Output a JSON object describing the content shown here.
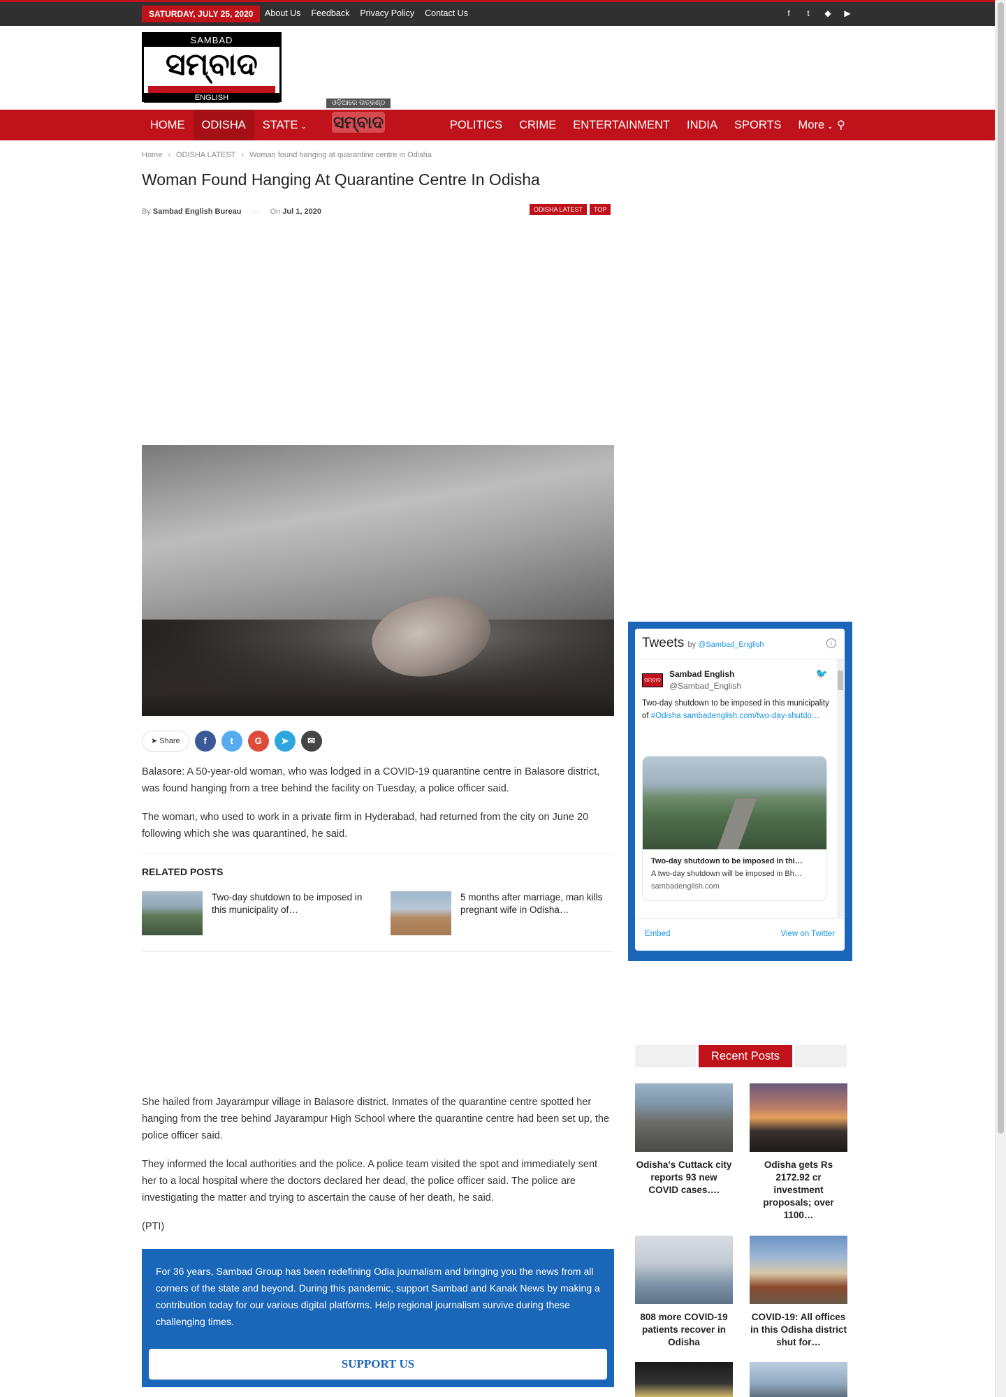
{
  "topbar": {
    "date": "SATURDAY, JULY 25, 2020",
    "links": [
      "About Us",
      "Feedback",
      "Privacy Policy",
      "Contact Us"
    ],
    "social_icons": [
      "facebook-icon",
      "twitter-icon",
      "android-icon",
      "youtube-icon"
    ]
  },
  "logo": {
    "top": "SAMBAD",
    "main": "ସମ୍ବାଦ",
    "bottom": "ENGLISH"
  },
  "nav": {
    "items": [
      "HOME",
      "ODISHA",
      "STATE",
      "POLITICS",
      "CRIME",
      "ENTERTAINMENT",
      "INDIA",
      "SPORTS",
      "More"
    ],
    "active": "ODISHA",
    "center_logo_tag": "ଓଡ଼ିଆରେ ଉତ୍କଣ୍ଠ",
    "center_logo_mark": "ସମ୍ବାଦ"
  },
  "breadcrumb": [
    "Home",
    "ODISHA LATEST",
    "Woman found hanging at quarantine centre in Odisha"
  ],
  "article": {
    "title": "Woman Found Hanging At Quarantine Centre In Odisha",
    "by_label": "By",
    "author": "Sambad English Bureau",
    "on_label": "On",
    "date": "Jul 1, 2020",
    "categories": [
      "ODISHA LATEST",
      "TOP"
    ],
    "share_label": "Share",
    "p1": "Balasore: A 50-year-old woman, who was lodged in a COVID-19 quarantine centre in Balasore district, was found hanging from a tree behind the facility on Tuesday, a police officer said.",
    "p2": "The woman, who used to work in a private firm in Hyderabad, had returned from the city on June 20 following which she was quarantined, he said.",
    "p3": "She hailed from Jayarampur village in Balasore district. Inmates of the quarantine centre spotted her hanging from the tree behind Jayarampur High School where the quarantine centre had been set up, the police officer said.",
    "p4": "They informed the local authorities and the police. A police team visited the spot and immediately sent her to a local hospital where the doctors declared her dead, the police officer said. The police are investigating the matter and trying to ascertain the cause of her death, he said.",
    "p5": "(PTI)"
  },
  "related": {
    "heading": "RELATED POSTS",
    "posts": [
      {
        "title": "Two-day shutdown to be imposed in this municipality of…"
      },
      {
        "title": "5 months after marriage, man kills pregnant wife in Odisha…"
      }
    ]
  },
  "support": {
    "text": "For 36 years, Sambad Group has been redefining Odia journalism and bringing you the news from all corners of the state and beyond. During this pandemic, support Sambad and Kanak News by making a contribution today for our various digital platforms. Help regional journalism survive during these challenging times.",
    "button": "SUPPORT US"
  },
  "twitter": {
    "title": "Tweets",
    "by": "by",
    "handle_link": "@Sambad_English",
    "user_name": "Sambad English",
    "user_handle": "@Sambad_English",
    "tweet_text_a": "Two-day shutdown to be imposed in this municipality of ",
    "tweet_link": "#Odisha sambadenglish.com/two-day-shutdo…",
    "card_title": "Two-day shutdown to be imposed in thi…",
    "card_desc": "A two-day shutdown will be imposed in Bh…",
    "card_url": "sambadenglish.com",
    "embed": "Embed",
    "view_on_twitter": "View on Twitter"
  },
  "recent": {
    "heading": "Recent Posts",
    "posts": [
      {
        "title": "Odisha's Cuttack city reports 93 new COVID cases…."
      },
      {
        "title": "Odisha gets Rs 2172.92 cr investment proposals; over 1100…"
      },
      {
        "title": "808 more COVID-19 patients recover in Odisha"
      },
      {
        "title": "COVID-19: All offices in this Odisha district shut for…"
      }
    ]
  },
  "colors": {
    "brand_red": "#c0121a",
    "support_blue": "#1a66b8",
    "twitter_blue": "#1b95e0"
  }
}
